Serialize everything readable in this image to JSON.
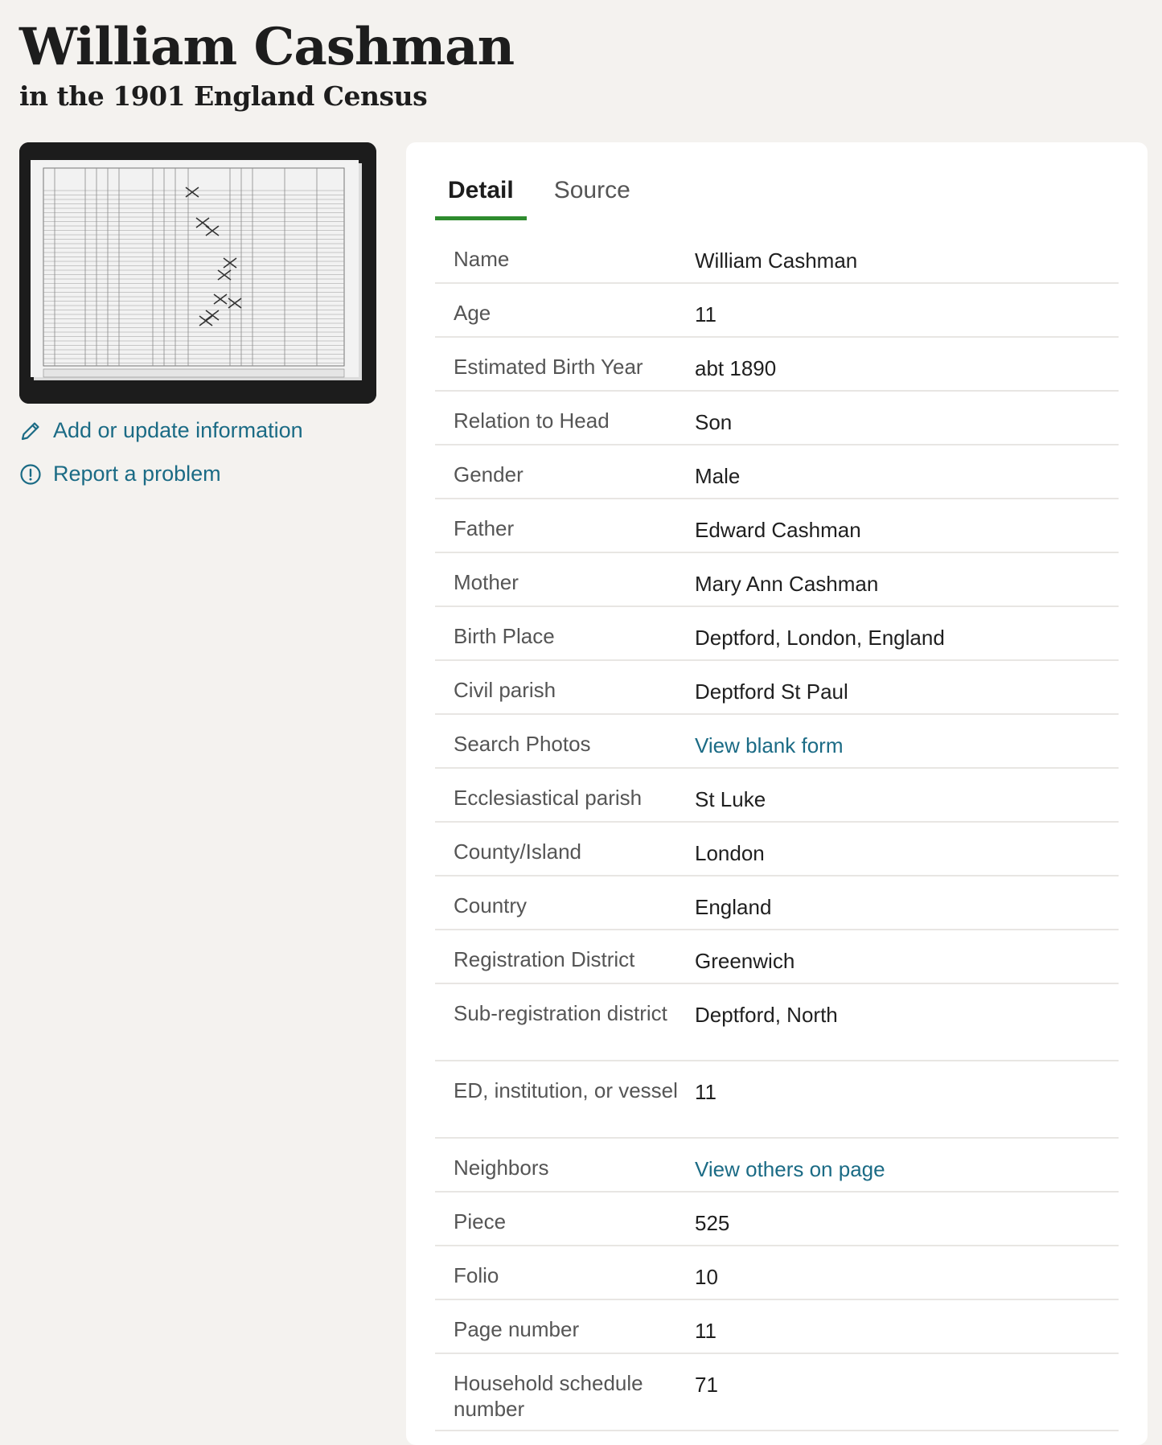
{
  "page": {
    "title": "William Cashman",
    "subtitle": "in the 1901 England Census"
  },
  "sidebar": {
    "add_link": "Add or update information",
    "report_link": "Report a problem",
    "thumbnail_icon": "census-record-image"
  },
  "tabs": [
    {
      "label": "Detail",
      "active": true
    },
    {
      "label": "Source",
      "active": false
    }
  ],
  "details": [
    {
      "label": "Name",
      "value": "William Cashman",
      "link": false
    },
    {
      "label": "Age",
      "value": "11",
      "link": false
    },
    {
      "label": "Estimated Birth Year",
      "value": "abt 1890",
      "link": false
    },
    {
      "label": "Relation to Head",
      "value": "Son",
      "link": false
    },
    {
      "label": "Gender",
      "value": "Male",
      "link": false
    },
    {
      "label": "Father",
      "value": "Edward Cashman",
      "link": false
    },
    {
      "label": "Mother",
      "value": "Mary Ann Cashman",
      "link": false
    },
    {
      "label": "Birth Place",
      "value": "Deptford, London, England",
      "link": false
    },
    {
      "label": "Civil parish",
      "value": "Deptford St Paul",
      "link": false
    },
    {
      "label": "Search Photos",
      "value": "View blank form",
      "link": true
    },
    {
      "label": "Ecclesiastical parish",
      "value": "St Luke",
      "link": false
    },
    {
      "label": "County/Island",
      "value": "London",
      "link": false
    },
    {
      "label": "Country",
      "value": "England",
      "link": false
    },
    {
      "label": "Registration District",
      "value": "Greenwich",
      "link": false
    },
    {
      "label": "Sub-registration district",
      "value": "Deptford, North",
      "link": false
    },
    {
      "label": "ED, institution, or vessel",
      "value": "11",
      "link": false
    },
    {
      "label": "Neighbors",
      "value": "View others on page",
      "link": true
    },
    {
      "label": "Piece",
      "value": "525",
      "link": false
    },
    {
      "label": "Folio",
      "value": "10",
      "link": false
    },
    {
      "label": "Page number",
      "value": "11",
      "link": false
    },
    {
      "label": "Household schedule number",
      "value": "71",
      "link": false
    }
  ],
  "colors": {
    "link": "#1b6b85",
    "tab_underline": "#2e8b2e",
    "background": "#f4f2ef"
  }
}
